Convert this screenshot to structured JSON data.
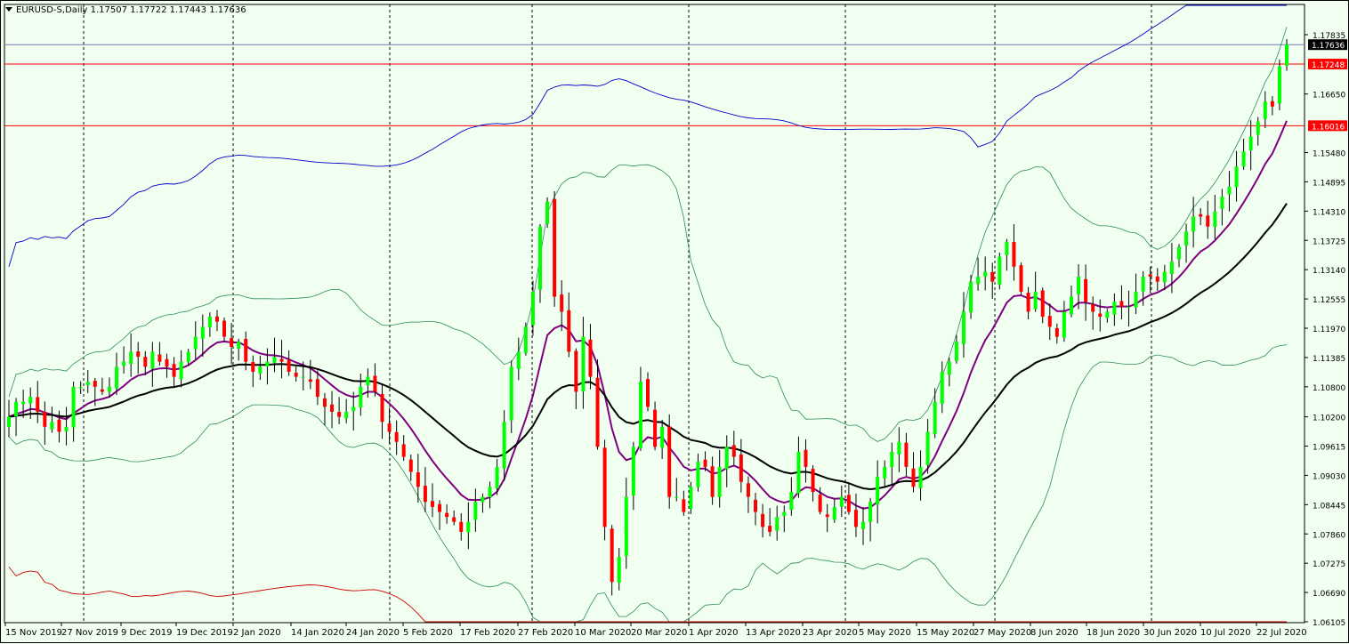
{
  "chart_data": {
    "type": "candlestick",
    "symbol": "EURUSD-S,Daily",
    "ohlc_header": [
      "1.17507",
      "1.17722",
      "1.17443",
      "1.17636"
    ],
    "y_ticks": [
      "1.17835",
      "1.16650",
      "1.15480",
      "1.14895",
      "1.14310",
      "1.13725",
      "1.13140",
      "1.12555",
      "1.11970",
      "1.11385",
      "1.10800",
      "1.10200",
      "1.09615",
      "1.09030",
      "1.08445",
      "1.07860",
      "1.07275",
      "1.06690",
      "1.06105"
    ],
    "x_ticks": [
      "15 Nov 2019",
      "27 Nov 2019",
      "9 Dec 2019",
      "19 Dec 2019",
      "2 Jan 2020",
      "14 Jan 2020",
      "24 Jan 2020",
      "5 Feb 2020",
      "17 Feb 2020",
      "27 Feb 2020",
      "10 Mar 2020",
      "20 Mar 2020",
      "1 Apr 2020",
      "13 Apr 2020",
      "23 Apr 2020",
      "5 May 2020",
      "15 May 2020",
      "27 May 2020",
      "8 Jun 2020",
      "18 Jun 2020",
      "30 Jun 2020",
      "10 Jul 2020",
      "22 Jul 2020"
    ],
    "price_labels": [
      {
        "value": 1.17636,
        "text": "1.17636",
        "kind": "bid"
      },
      {
        "value": 1.17248,
        "text": "1.17248",
        "kind": "level"
      },
      {
        "value": 1.16016,
        "text": "1.16016",
        "kind": "level"
      }
    ],
    "horizontal_lines": [
      1.17248,
      1.16016
    ],
    "bid": 1.17636,
    "ylim": [
      1.06105,
      1.17835
    ],
    "closes": [
      1.102,
      1.105,
      1.105,
      1.106,
      1.103,
      1.1,
      1.101,
      1.099,
      1.1,
      1.108,
      1.108,
      1.109,
      1.108,
      1.107,
      1.108,
      1.112,
      1.113,
      1.115,
      1.114,
      1.112,
      1.115,
      1.113,
      1.112,
      1.11,
      1.113,
      1.115,
      1.118,
      1.12,
      1.122,
      1.121,
      1.118,
      1.116,
      1.117,
      1.113,
      1.111,
      1.112,
      1.113,
      1.114,
      1.113,
      1.111,
      1.11,
      1.11,
      1.109,
      1.106,
      1.104,
      1.103,
      1.102,
      1.103,
      1.104,
      1.108,
      1.11,
      1.107,
      1.101,
      1.099,
      1.097,
      1.094,
      1.091,
      1.088,
      1.085,
      1.084,
      1.083,
      1.082,
      1.081,
      1.079,
      1.081,
      1.085,
      1.086,
      1.088,
      1.092,
      1.101,
      1.112,
      1.115,
      1.12,
      1.127,
      1.14,
      1.145,
      1.126,
      1.123,
      1.115,
      1.107,
      1.118,
      1.11,
      1.096,
      1.08,
      1.069,
      1.074,
      1.086,
      1.096,
      1.109,
      1.104,
      1.096,
      1.1,
      1.086,
      1.086,
      1.083,
      1.088,
      1.093,
      1.092,
      1.086,
      1.092,
      1.096,
      1.094,
      1.089,
      1.086,
      1.083,
      1.08,
      1.079,
      1.082,
      1.083,
      1.087,
      1.095,
      1.092,
      1.087,
      1.083,
      1.082,
      1.084,
      1.086,
      1.083,
      1.08,
      1.081,
      1.085,
      1.09,
      1.092,
      1.095,
      1.097,
      1.092,
      1.088,
      1.092,
      1.099,
      1.105,
      1.111,
      1.113,
      1.117,
      1.123,
      1.129,
      1.13,
      1.131,
      1.129,
      1.134,
      1.137,
      1.132,
      1.127,
      1.123,
      1.127,
      1.122,
      1.12,
      1.118,
      1.123,
      1.126,
      1.13,
      1.125,
      1.123,
      1.122,
      1.123,
      1.125,
      1.124,
      1.124,
      1.127,
      1.13,
      1.13,
      1.129,
      1.131,
      1.133,
      1.136,
      1.139,
      1.142,
      1.142,
      1.14,
      1.143,
      1.146,
      1.148,
      1.152,
      1.155,
      1.158,
      1.161,
      1.165,
      1.164,
      1.172,
      1.1764
    ]
  }
}
